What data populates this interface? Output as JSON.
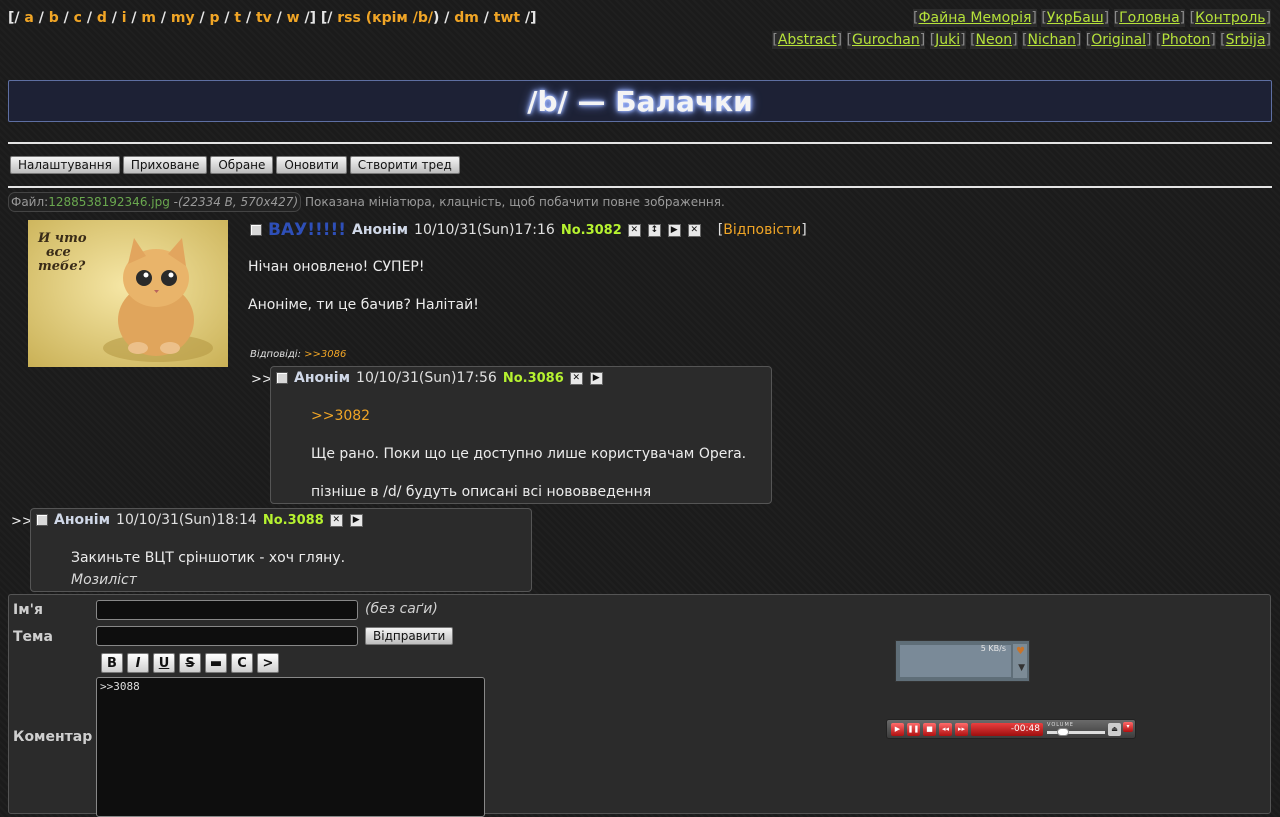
{
  "boards": {
    "open": "[/",
    "close": "/]",
    "items": [
      "a",
      "b",
      "c",
      "d",
      "i",
      "m",
      "my",
      "p",
      "t",
      "tv",
      "w"
    ],
    "group2_open": "[/",
    "rss": "rss",
    "paren_open": "(",
    "except_b": "крім /b/",
    "paren_close": ")",
    "dm": "dm",
    "twt": "twt",
    "close2": "/]",
    "slash": "/"
  },
  "top_links_row1": [
    "Файна Меморія",
    "УкрБаш",
    "Головна",
    "Контроль"
  ],
  "top_links_row2": [
    "Abstract",
    "Gurochan",
    "Juki",
    "Neon",
    "Nichan",
    "Original",
    "Photon",
    "Srbija"
  ],
  "logo_title": "/b/ — Балачки",
  "action_buttons": [
    "Налаштування",
    "Приховане",
    "Обране",
    "Оновити",
    "Створити тред"
  ],
  "op": {
    "file_label": "Файл:",
    "file_name": "1288538192346.jpg",
    "file_meta": "(22334 B, 570x427)",
    "file_prefix_dash": " -",
    "file_hint": "Показана мініатюра, клацність, щоб побачити повне зображення.",
    "thumb_caption": "И что все тебе?",
    "subject": "ВАУ!!!!!",
    "poster": "Анонім",
    "date": "10/10/31(Sun)17:16",
    "number": "No.3082",
    "reply_open": "[",
    "reply_label": "Відповісти",
    "reply_close": "]",
    "lines": [
      "Нічан оновлено! СУПЕР!",
      "Аноніме, ти це бачив? Налітай!"
    ],
    "replies_label": "Відповіді:",
    "replies_ref": ">>3086"
  },
  "reply1": {
    "arrow": ">>",
    "poster": "Анонім",
    "date": "10/10/31(Sun)17:56",
    "number": "No.3086",
    "quote": ">>3082",
    "lines": [
      "Ще рано. Поки що це доступно лише користувачам Opera.",
      "пізніше в /d/ будуть описані всі нововведення"
    ]
  },
  "reply2": {
    "arrow": ">>",
    "poster": "Анонім",
    "date": "10/10/31(Sun)18:14",
    "number": "No.3088",
    "line": "Закиньте ВЦТ сріншотик - хоч гляну.",
    "signature": "Мозиліст"
  },
  "form": {
    "name_label": "Ім'я",
    "subject_label": "Тема",
    "comment_label": "Коментар",
    "nosage": "(без саґи)",
    "submit": "Відправити",
    "format_buttons": [
      "B",
      "I",
      "U",
      "S",
      "▬",
      "C",
      ">"
    ],
    "comment_value": ">>3088"
  },
  "widgets": {
    "speed": "5 KB/s",
    "player_time": "-00:48",
    "player_volume": "VOLUME",
    "player_controls": [
      "▶",
      "❚❚",
      "■",
      "◂◂",
      "▸▸"
    ],
    "eject": "⏏",
    "menu": "▾"
  },
  "colors": {
    "accent_orange": "#f0a526",
    "post_number": "#b6f230",
    "link_green": "#b6e23a",
    "subject_blue": "#2e4fb8"
  }
}
